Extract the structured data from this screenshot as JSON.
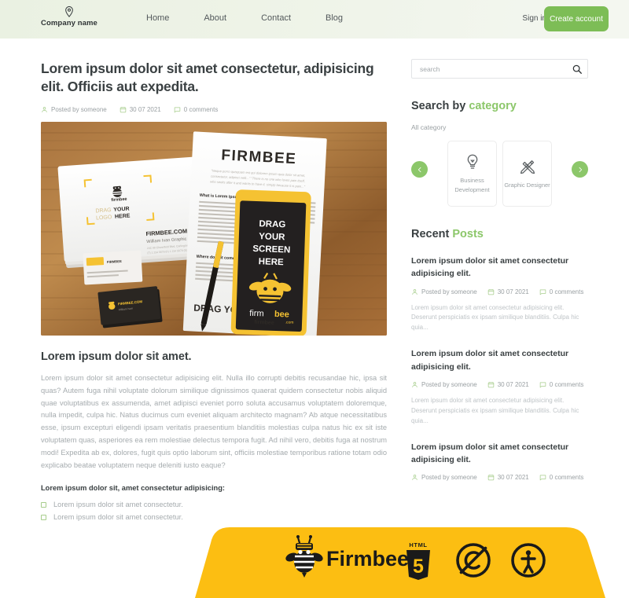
{
  "header": {
    "brand_name": "Company name",
    "logo_icon": "location-pin-icon",
    "nav": [
      {
        "label": "Home"
      },
      {
        "label": "About"
      },
      {
        "label": "Contact"
      },
      {
        "label": "Blog"
      }
    ],
    "signin_label": "Sign in",
    "cta_label": "Create account",
    "accent_color": "#7dbd56",
    "background_color": "#eef3e7"
  },
  "article": {
    "title": "Lorem ipsum dolor sit amet consectetur, adipisicing elit. Officiis aut expedita.",
    "meta": {
      "author": "Posted by someone",
      "date": "30 07 2021",
      "comments": "0 comments",
      "author_icon": "user-icon",
      "date_icon": "calendar-icon",
      "comments_icon": "comment-icon"
    },
    "hero_image_alt": "Firmbee branded stationery mockup on wooden desk with envelope, brochure and smartphone",
    "section_title": "Lorem ipsum dolor sit amet.",
    "body": "Lorem ipsum dolor sit amet consectetur adipisicing elit. Nulla illo corrupti debitis recusandae hic, ipsa sit quas? Autem fuga nihil voluptate dolorum similique dignissimos quaerat quidem consectetur nobis aliquid quae voluptatibus ex assumenda, amet adipisci eveniet porro soluta accusamus voluptatem doloremque, nulla impedit, culpa hic. Natus ducimus cum eveniet aliquam architecto magnam? Ab atque necessitatibus esse, ipsum excepturi eligendi ipsam veritatis praesentium blanditiis molestias culpa natus hic ex sit iste voluptatem quas, asperiores ea rem molestiae delectus tempora fugit. Ad nihil vero, debitis fuga at nostrum modi! Expedita ab ex, dolores, fugit quis optio laborum sint, officiis molestiae temporibus ratione totam odio explicabo beatae voluptatem neque deleniti iusto eaque?",
    "sub_head": "Lorem ipsum dolor sit, amet consectetur adipisicing:",
    "checklist": [
      {
        "label": "Lorem ipsum dolor sit amet consectetur."
      },
      {
        "label": "Lorem ipsum dolor sit amet consectetur."
      }
    ]
  },
  "sidebar": {
    "search": {
      "placeholder": "search",
      "value": "",
      "icon": "search-icon"
    },
    "category_section": {
      "title_plain": "Search by ",
      "title_accent": "category",
      "all_category_label": "All category",
      "prev_icon": "chevron-left-icon",
      "next_icon": "chevron-right-icon",
      "cards": [
        {
          "label": "Business Development",
          "icon": "lightbulb-icon"
        },
        {
          "label": "Graphic Designer",
          "icon": "pencil-ruler-icon"
        }
      ]
    },
    "recent_section": {
      "title_plain": "Recent ",
      "title_accent": "Posts",
      "posts": [
        {
          "title": "Lorem ipsum dolor sit amet consectetur adipisicing elit.",
          "author": "Posted by someone",
          "date": "30 07 2021",
          "comments": "0 comments",
          "excerpt": "Lorem ipsum dolor sit amet consectetur adipisicing elit. Deserunt perspiciatis ex ipsam similique blanditiis. Culpa hic quia..."
        },
        {
          "title": "Lorem ipsum dolor sit amet consectetur adipisicing elit.",
          "author": "Posted by someone",
          "date": "30 07 2021",
          "comments": "0 comments",
          "excerpt": "Lorem ipsum dolor sit amet consectetur adipisicing elit. Deserunt perspiciatis ex ipsam similique blanditiis. Culpa hic quia..."
        },
        {
          "title": "Lorem ipsum dolor sit amet consectetur adipisicing elit.",
          "author": "Posted by someone",
          "date": "30 07 2021",
          "comments": "0 comments",
          "excerpt": ""
        }
      ]
    }
  },
  "footer": {
    "background_color": "#fcbe12",
    "brand_text": "Firmbee",
    "logos": [
      {
        "name": "firmbee-bee-logo"
      },
      {
        "name": "html5-badge-icon"
      },
      {
        "name": "copyleft-icon"
      },
      {
        "name": "accessibility-icon"
      }
    ]
  }
}
